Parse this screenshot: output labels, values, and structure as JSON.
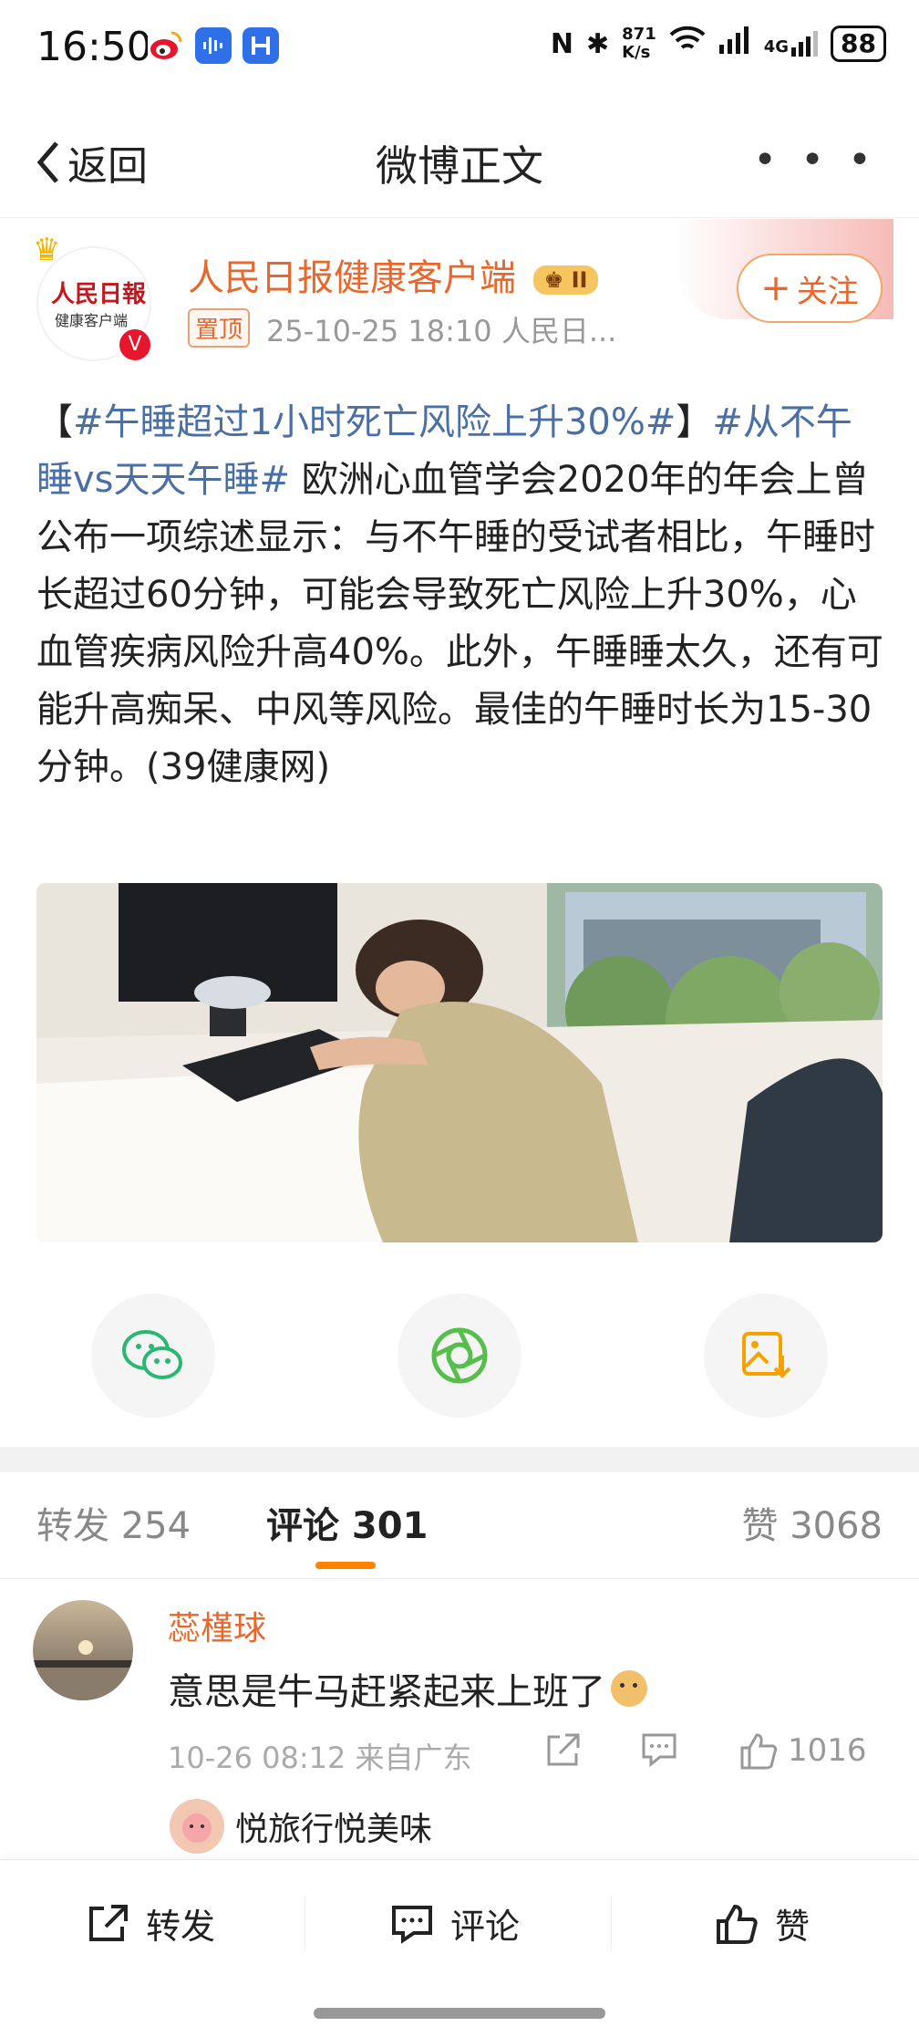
{
  "status_bar": {
    "time": "16:50",
    "net_speed_top": "871",
    "net_speed_bottom": "K/s",
    "signal_label": "4G",
    "battery": "88",
    "icons": [
      "weibo-app-icon",
      "voice-app-icon",
      "bracket-app-icon",
      "nfc-icon",
      "bluetooth-icon",
      "wifi-icon",
      "signal-icon",
      "signal-4g-icon",
      "battery-icon"
    ]
  },
  "nav": {
    "back_label": "返回",
    "title": "微博正文",
    "more_label": "• • •"
  },
  "author": {
    "name": "人民日报健康客户端",
    "level_badge": "II",
    "logo_text_top": "人民日報",
    "logo_text_bottom": "健康客户端",
    "pinned_label": "置顶",
    "meta": "25-10-25 18:10  人民日...",
    "follow_label": "关注",
    "accent_color": "#e8672c"
  },
  "post": {
    "bracket_open": "【",
    "tag1": "#午睡超过1小时死亡风险上升30%#",
    "bracket_close": "】",
    "tag2": "#从不午睡vs天天午睡#",
    "text": " 欧洲心血管学会2020年的年会上曾公布一项综述显示：与不午睡的受试者相比，午睡时长超过60分钟，可能会导致死亡风险上升30%，心血管疾病风险升高40%。此外，午睡睡太久，还有可能升高痴呆、中风等风险。最佳的午睡时长为15-30分钟。(39健康网)",
    "tag_color": "#4a6fa5"
  },
  "share": {
    "icons": [
      "wechat-icon",
      "moments-icon",
      "save-image-icon"
    ]
  },
  "tabs": {
    "repost": "转发 254",
    "comment": "评论 301",
    "like": "赞 3068",
    "underline_color": "#ff8200"
  },
  "comment": {
    "user": "蕊槿球",
    "text": "意思是牛马赶紧起来上班了",
    "meta": "10-26 08:12 来自广东",
    "likes": "1016",
    "reply_user": "悦旅行悦美味"
  },
  "bottom_bar": {
    "repost": "转发",
    "comment": "评论",
    "like": "赞"
  }
}
